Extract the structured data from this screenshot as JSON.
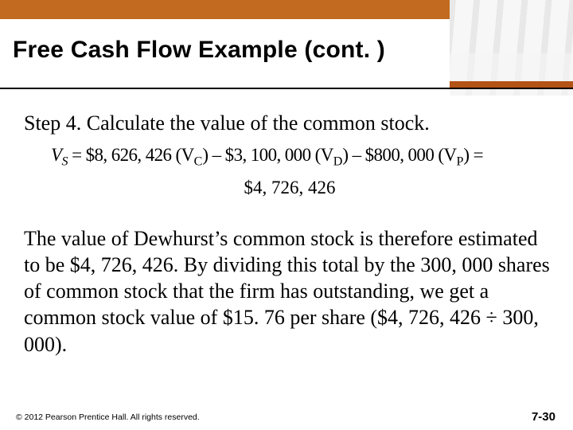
{
  "header": {
    "title": "Free Cash Flow Example (cont. )"
  },
  "body": {
    "step_heading": "Step 4. Calculate the value of the common stock.",
    "formula": {
      "lhs_var": "V",
      "lhs_sub": "S",
      "vc_val": "$8, 626, 426",
      "vc_label": "V",
      "vc_sub": "C",
      "vd_val": "$3, 100, 000",
      "vd_label": "V",
      "vd_sub": "D",
      "vp_val": "$800, 000",
      "vp_label": "V",
      "vp_sub": "P",
      "equals": "=",
      "minus": "–"
    },
    "result": "$4, 726, 426",
    "paragraph": "The value of Dewhurst’s common stock is therefore estimated to be $4, 726, 426. By dividing this total by the 300, 000 shares of common stock that the firm has outstanding, we get a common stock value of $15. 76 per share ($4, 726, 426 ÷ 300, 000)."
  },
  "footer": {
    "copyright": "© 2012 Pearson Prentice Hall. All rights reserved.",
    "page": "7-30"
  }
}
